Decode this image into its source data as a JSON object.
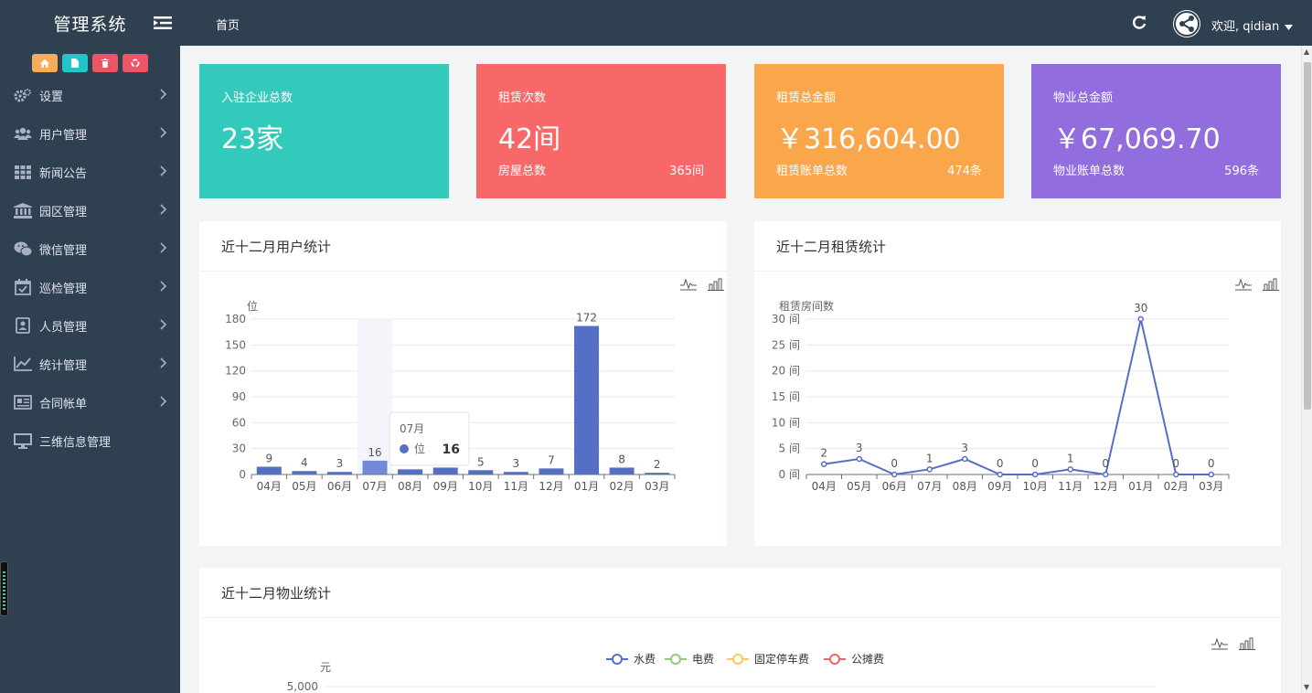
{
  "app": {
    "title": "管理系统"
  },
  "header": {
    "home_tab": "首页",
    "welcome": "欢迎, qidian"
  },
  "sidebar": {
    "quick_buttons": [
      {
        "icon": "home-icon",
        "color": "#f8ac59"
      },
      {
        "icon": "file-icon",
        "color": "#23c6c8"
      },
      {
        "icon": "trash-icon",
        "color": "#ed5565"
      },
      {
        "icon": "recycle-icon",
        "color": "#ed5565"
      }
    ],
    "items": [
      {
        "label": "设置",
        "icon": "gears-icon",
        "has_children": true
      },
      {
        "label": "用户管理",
        "icon": "users-icon",
        "has_children": true
      },
      {
        "label": "新闻公告",
        "icon": "grid-icon",
        "has_children": true
      },
      {
        "label": "园区管理",
        "icon": "bank-icon",
        "has_children": true
      },
      {
        "label": "微信管理",
        "icon": "wechat-icon",
        "has_children": true
      },
      {
        "label": "巡检管理",
        "icon": "calendar-check-icon",
        "has_children": true
      },
      {
        "label": "人员管理",
        "icon": "contact-icon",
        "has_children": true
      },
      {
        "label": "统计管理",
        "icon": "line-chart-icon",
        "has_children": true
      },
      {
        "label": "合同帐单",
        "icon": "newspaper-icon",
        "has_children": true
      },
      {
        "label": "三维信息管理",
        "icon": "desktop-icon",
        "has_children": false
      }
    ]
  },
  "stats": [
    {
      "title": "入驻企业总数",
      "value": "23家",
      "sub_label": "",
      "sub_value": "",
      "color": "#33cabb"
    },
    {
      "title": "租赁次数",
      "value": "42间",
      "sub_label": "房屋总数",
      "sub_value": "365间",
      "color": "#f96868"
    },
    {
      "title": "租赁总金额",
      "value": "￥316,604.00",
      "sub_label": "租赁账单总数",
      "sub_value": "474条",
      "color": "#faa64b"
    },
    {
      "title": "物业总金额",
      "value": "￥67,069.70",
      "sub_label": "物业账单总数",
      "sub_value": "596条",
      "color": "#926dde"
    }
  ],
  "panels": {
    "user_stats": {
      "title": "近十二月用户统计"
    },
    "rental_stats": {
      "title": "近十二月租赁统计"
    },
    "property_stats": {
      "title": "近十二月物业统计"
    }
  },
  "chart_data": [
    {
      "type": "bar",
      "categories": [
        "04月",
        "05月",
        "06月",
        "07月",
        "08月",
        "09月",
        "10月",
        "11月",
        "12月",
        "01月",
        "02月",
        "03月"
      ],
      "values": [
        9,
        4,
        3,
        16,
        6,
        8,
        5,
        3,
        7,
        172,
        8,
        2
      ],
      "ylabel": "位",
      "ylim": [
        0,
        180
      ],
      "yticks": [
        0,
        30,
        60,
        90,
        120,
        150,
        180
      ],
      "color": "#5470c6",
      "tooltip": {
        "category": "07月",
        "series": "位",
        "value": "16"
      }
    },
    {
      "type": "line",
      "categories": [
        "04月",
        "05月",
        "06月",
        "07月",
        "08月",
        "09月",
        "10月",
        "11月",
        "12月",
        "01月",
        "02月",
        "03月"
      ],
      "values": [
        2,
        3,
        0,
        1,
        3,
        0,
        0,
        1,
        0,
        30,
        0,
        0
      ],
      "ylabel": "租赁房间数",
      "ylim": [
        0,
        30
      ],
      "yticks": [
        "0 间",
        "5 间",
        "10 间",
        "15 间",
        "20 间",
        "25 间",
        "30 间"
      ],
      "color": "#5470c6"
    },
    {
      "type": "line",
      "legend": [
        {
          "name": "水费",
          "color": "#5470c6"
        },
        {
          "name": "电费",
          "color": "#91cc75"
        },
        {
          "name": "固定停车费",
          "color": "#fac858"
        },
        {
          "name": "公摊费",
          "color": "#ee6666"
        }
      ],
      "ylabel": "元",
      "yticks_visible": [
        "5,000"
      ]
    }
  ]
}
